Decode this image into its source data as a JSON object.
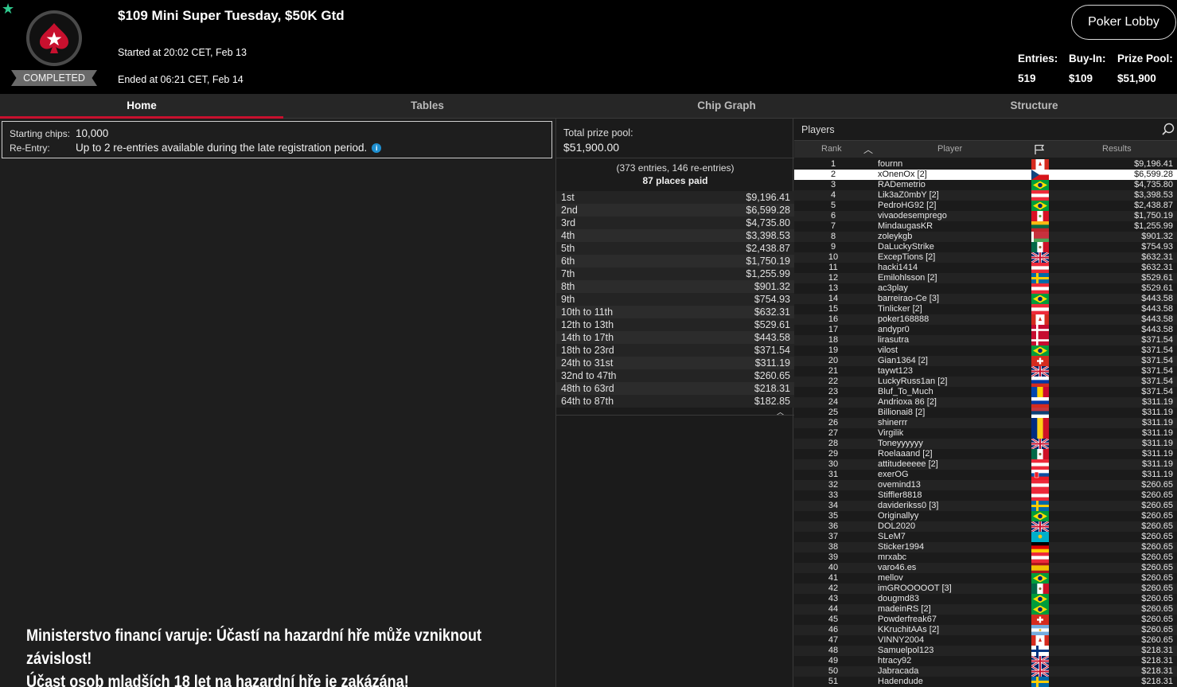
{
  "header": {
    "title": "$109 Mini Super Tuesday, $50K Gtd",
    "started": "Started at 20:02 CET, Feb 13",
    "ended": "Ended at 06:21 CET, Feb 14",
    "status_badge": "COMPLETED",
    "lobby_button": "Poker Lobby",
    "entries_label": "Entries:",
    "entries_value": "519",
    "buyin_label": "Buy-In:",
    "buyin_value": "$109",
    "prizepool_label": "Prize Pool:",
    "prizepool_value": "$51,900"
  },
  "tabs": [
    "Home",
    "Tables",
    "Chip Graph",
    "Structure"
  ],
  "info": {
    "starting_chips_label": "Starting chips:",
    "starting_chips_value": "10,000",
    "reentry_label": "Re-Entry:",
    "reentry_value": "Up to 2 re-entries available during the late registration period."
  },
  "prize": {
    "label": "Total prize pool:",
    "value": "$51,900.00",
    "entries_note": "(373 entries, 146 re-entries)",
    "places_paid": "87 places paid",
    "payouts": [
      {
        "place": "1st",
        "amount": "$9,196.41"
      },
      {
        "place": "2nd",
        "amount": "$6,599.28"
      },
      {
        "place": "3rd",
        "amount": "$4,735.80"
      },
      {
        "place": "4th",
        "amount": "$3,398.53"
      },
      {
        "place": "5th",
        "amount": "$2,438.87"
      },
      {
        "place": "6th",
        "amount": "$1,750.19"
      },
      {
        "place": "7th",
        "amount": "$1,255.99"
      },
      {
        "place": "8th",
        "amount": "$901.32"
      },
      {
        "place": "9th",
        "amount": "$754.93"
      },
      {
        "place": "10th to 11th",
        "amount": "$632.31"
      },
      {
        "place": "12th to 13th",
        "amount": "$529.61"
      },
      {
        "place": "14th to 17th",
        "amount": "$443.58"
      },
      {
        "place": "18th to 23rd",
        "amount": "$371.54"
      },
      {
        "place": "24th to 31st",
        "amount": "$311.19"
      },
      {
        "place": "32nd to 47th",
        "amount": "$260.65"
      },
      {
        "place": "48th to 63rd",
        "amount": "$218.31"
      },
      {
        "place": "64th to 87th",
        "amount": "$182.85"
      }
    ]
  },
  "players": {
    "title": "Players",
    "col_rank": "Rank",
    "col_player": "Player",
    "col_results": "Results",
    "selected_rank": 2,
    "rows": [
      {
        "rank": "1",
        "name": "fournn",
        "flag": "ca",
        "result": "$9,196.41"
      },
      {
        "rank": "2",
        "name": "xOnenOx [2]",
        "flag": "cz",
        "result": "$6,599.28"
      },
      {
        "rank": "3",
        "name": "RADemetrio",
        "flag": "br",
        "result": "$4,735.80"
      },
      {
        "rank": "4",
        "name": "Lik3aZ0mbY [2]",
        "flag": "at",
        "result": "$3,398.53"
      },
      {
        "rank": "5",
        "name": "PedroHG92 [2]",
        "flag": "br",
        "result": "$2,438.87"
      },
      {
        "rank": "6",
        "name": "vivaodesemprego",
        "flag": "pe",
        "result": "$1,750.19"
      },
      {
        "rank": "7",
        "name": "MindaugasKR",
        "flag": "lt",
        "result": "$1,255.99"
      },
      {
        "rank": "8",
        "name": "zoleykgb",
        "flag": "by",
        "result": "$901.32"
      },
      {
        "rank": "9",
        "name": "DaLuckyStrike",
        "flag": "mx",
        "result": "$754.93"
      },
      {
        "rank": "10",
        "name": "ExcepTions [2]",
        "flag": "uk",
        "result": "$632.31"
      },
      {
        "rank": "11",
        "name": "hacki1414",
        "flag": "at",
        "result": "$632.31"
      },
      {
        "rank": "12",
        "name": "Emilohlsson [2]",
        "flag": "se",
        "result": "$529.61"
      },
      {
        "rank": "13",
        "name": "ac3play",
        "flag": "at",
        "result": "$529.61"
      },
      {
        "rank": "14",
        "name": "barreirao-Ce [3]",
        "flag": "br",
        "result": "$443.58"
      },
      {
        "rank": "15",
        "name": "Tinlicker [2]",
        "flag": "at",
        "result": "$443.58"
      },
      {
        "rank": "16",
        "name": "poker168888",
        "flag": "ca",
        "result": "$443.58"
      },
      {
        "rank": "17",
        "name": "andypr0",
        "flag": "dk",
        "result": "$443.58"
      },
      {
        "rank": "18",
        "name": "lirasutra",
        "flag": "dk",
        "result": "$371.54"
      },
      {
        "rank": "19",
        "name": "vilost",
        "flag": "br",
        "result": "$371.54"
      },
      {
        "rank": "20",
        "name": "Gian1364 [2]",
        "flag": "ch",
        "result": "$371.54"
      },
      {
        "rank": "21",
        "name": "taywt123",
        "flag": "uk",
        "result": "$371.54"
      },
      {
        "rank": "22",
        "name": "LuckyRuss1an [2]",
        "flag": "ru",
        "result": "$371.54"
      },
      {
        "rank": "23",
        "name": "Bluf_To_Much",
        "flag": "md",
        "result": "$371.54"
      },
      {
        "rank": "24",
        "name": "Andrioxa 86 [2]",
        "flag": "ru",
        "result": "$311.19"
      },
      {
        "rank": "25",
        "name": "Billionai8 [2]",
        "flag": "rs",
        "result": "$311.19"
      },
      {
        "rank": "26",
        "name": "shinerrr",
        "flag": "ro",
        "result": "$311.19"
      },
      {
        "rank": "27",
        "name": "Virgilik",
        "flag": "ro",
        "result": "$311.19"
      },
      {
        "rank": "28",
        "name": "Toneyyyyyy",
        "flag": "uk",
        "result": "$311.19"
      },
      {
        "rank": "29",
        "name": "Roelaaand [2]",
        "flag": "mx",
        "result": "$311.19"
      },
      {
        "rank": "30",
        "name": "attitudeeeee [2]",
        "flag": "at",
        "result": "$311.19"
      },
      {
        "rank": "31",
        "name": "exerOG",
        "flag": "sk",
        "result": "$311.19"
      },
      {
        "rank": "32",
        "name": "ovemind13",
        "flag": "at",
        "result": "$260.65"
      },
      {
        "rank": "33",
        "name": "Stiffler8818",
        "flag": "at",
        "result": "$260.65"
      },
      {
        "rank": "34",
        "name": "daviderikss0 [3]",
        "flag": "se",
        "result": "$260.65"
      },
      {
        "rank": "35",
        "name": "Originallyy",
        "flag": "br",
        "result": "$260.65"
      },
      {
        "rank": "36",
        "name": "DOL2020",
        "flag": "uk",
        "result": "$260.65"
      },
      {
        "rank": "37",
        "name": "SLeM7",
        "flag": "kz",
        "result": "$260.65"
      },
      {
        "rank": "38",
        "name": "Sticker1994",
        "flag": "de",
        "result": "$260.65"
      },
      {
        "rank": "39",
        "name": "mrxabc",
        "flag": "at",
        "result": "$260.65"
      },
      {
        "rank": "40",
        "name": "varo46.es",
        "flag": "es",
        "result": "$260.65"
      },
      {
        "rank": "41",
        "name": "mellov",
        "flag": "br",
        "result": "$260.65"
      },
      {
        "rank": "42",
        "name": "imGROOOOOT [3]",
        "flag": "mx",
        "result": "$260.65"
      },
      {
        "rank": "43",
        "name": "dougmd83",
        "flag": "br",
        "result": "$260.65"
      },
      {
        "rank": "44",
        "name": "madeinRS [2]",
        "flag": "br",
        "result": "$260.65"
      },
      {
        "rank": "45",
        "name": "Powderfreak67",
        "flag": "ch",
        "result": "$260.65"
      },
      {
        "rank": "46",
        "name": "KKruchitAAs [2]",
        "flag": "ar",
        "result": "$260.65"
      },
      {
        "rank": "47",
        "name": "VINNY2004",
        "flag": "ca",
        "result": "$260.65"
      },
      {
        "rank": "48",
        "name": "Samuelpol123",
        "flag": "fi",
        "result": "$218.31"
      },
      {
        "rank": "49",
        "name": "htracy92",
        "flag": "uk",
        "result": "$218.31"
      },
      {
        "rank": "50",
        "name": "Jabracada",
        "flag": "uk",
        "result": "$218.31"
      },
      {
        "rank": "51",
        "name": "Hadendude",
        "flag": "se",
        "result": "$218.31"
      }
    ]
  },
  "warning": {
    "line1": "Ministerstvo financí varuje: Účastí na hazardní hře může vzniknout závislost!",
    "line2": "Účast osob mladších 18 let na hazardní hře je zakázána!"
  },
  "colors": {
    "accent_red": "#c8102e",
    "star_green": "#2fc98e",
    "info_blue": "#1e8fd0"
  }
}
